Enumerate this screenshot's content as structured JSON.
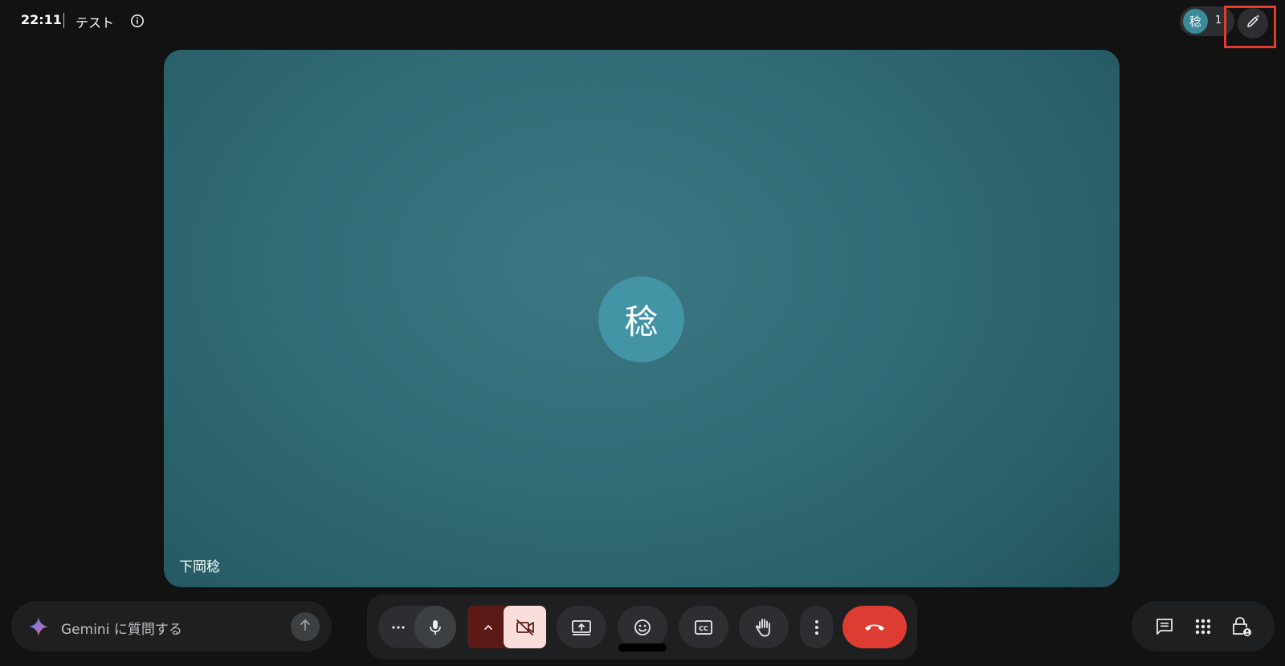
{
  "header": {
    "time": "22:11",
    "meeting_title": "テスト",
    "participant_initial": "稔",
    "participant_count": "1"
  },
  "tile": {
    "avatar_initial": "稔",
    "participant_name": "下岡稔"
  },
  "gemini": {
    "placeholder": "Gemini に質問する"
  },
  "colors": {
    "background": "#121212",
    "tile": "#306b76",
    "avatar": "#4394a4",
    "hangup": "#dc3c31",
    "camera_off": "#f9dedc",
    "highlight": "#e43b2c"
  },
  "icons": {
    "info": "info-icon",
    "effects": "sparkle-pencil-icon",
    "gemini": "gemini-sparkle-icon",
    "send": "arrow-up-icon",
    "more_options": "horizontal-dots-icon",
    "mic": "mic-icon",
    "camera_options": "chevron-up-icon",
    "camera": "camera-off-icon",
    "present": "present-screen-icon",
    "emoji": "emoji-icon",
    "captions": "captions-icon",
    "raise_hand": "hand-icon",
    "more": "vertical-dots-icon",
    "hangup": "phone-hangup-icon",
    "chat": "chat-icon",
    "activities": "apps-grid-icon",
    "host_controls": "lock-person-icon"
  }
}
